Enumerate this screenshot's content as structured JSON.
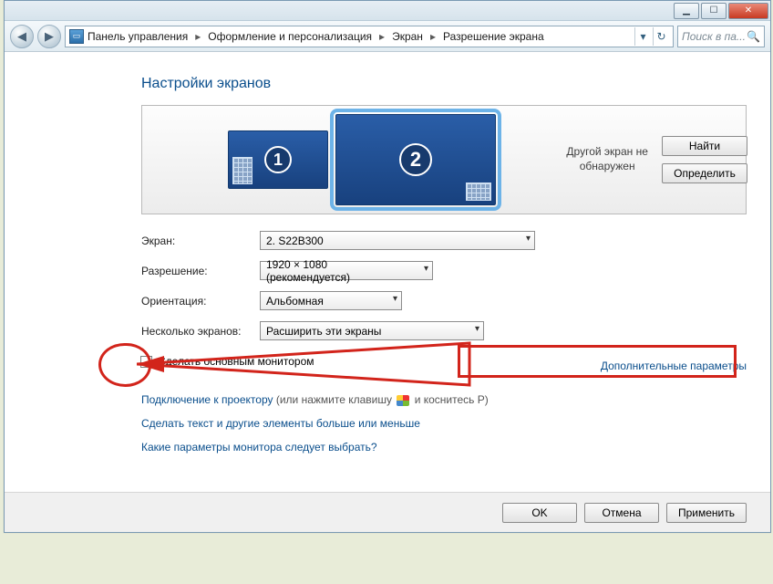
{
  "window": {
    "min": "▁",
    "max": "☐",
    "close": "✕"
  },
  "nav": {
    "back": "◀",
    "forward": "▶",
    "icon_glyph": "🖵",
    "crumbs": [
      "Панель управления",
      "Оформление и персонализация",
      "Экран",
      "Разрешение экрана"
    ],
    "dropdown": "▾",
    "refresh": "↻",
    "search_placeholder": "Поиск в па..."
  },
  "page": {
    "title": "Настройки экранов",
    "not_detected": "Другой экран не обнаружен",
    "btn_find": "Найти",
    "btn_detect": "Определить",
    "mon1": "1",
    "mon2": "2",
    "labels": {
      "display": "Экран:",
      "resolution": "Разрешение:",
      "orientation": "Ориентация:",
      "multi": "Несколько экранов:"
    },
    "values": {
      "display": "2. S22B300",
      "resolution": "1920 × 1080 (рекомендуется)",
      "orientation": "Альбомная",
      "multi": "Расширить эти экраны"
    },
    "checkbox_label": "Сделать основным монитором",
    "adv_link": "Дополнительные параметры",
    "projector_link": "Подключение к проектору",
    "projector_tail_a": " (или нажмите клавишу ",
    "projector_tail_b": " и коснитесь P)",
    "text_size_link": "Сделать текст и другие элементы больше или меньше",
    "which_settings_link": "Какие параметры монитора следует выбрать?",
    "btn_ok": "OK",
    "btn_cancel": "Отмена",
    "btn_apply": "Применить"
  }
}
